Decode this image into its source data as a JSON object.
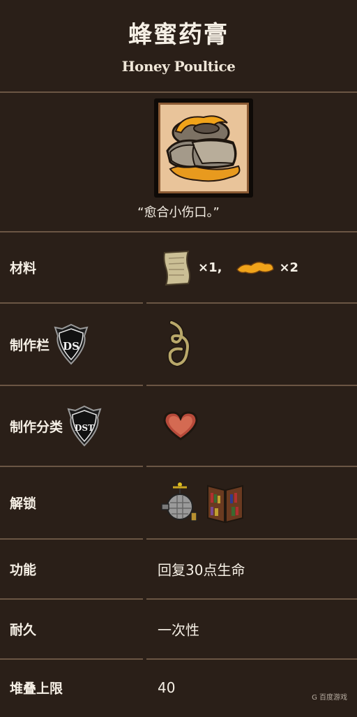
{
  "header": {
    "title": "蜂蜜药膏",
    "subtitle": "Honey Poultice"
  },
  "item": {
    "quote": "“愈合小伤口。”"
  },
  "rows": {
    "materials": {
      "label": "材料",
      "papyrus_count": "×1,",
      "honey_count": "×2"
    },
    "craft_tab": {
      "label": "制作栏",
      "badge": "DS"
    },
    "craft_category": {
      "label": "制作分类",
      "badge": "DST"
    },
    "unlock": {
      "label": "解锁"
    },
    "function": {
      "label": "功能",
      "value": "回复30点生命"
    },
    "durability": {
      "label": "耐久",
      "value": "一次性"
    },
    "stack": {
      "label": "堆叠上限",
      "value": "40"
    }
  },
  "watermark": {
    "text": "G 百度游戏"
  },
  "colors": {
    "background": "#2a1f18",
    "divider": "#6b5644",
    "text": "#f6f0e6"
  }
}
